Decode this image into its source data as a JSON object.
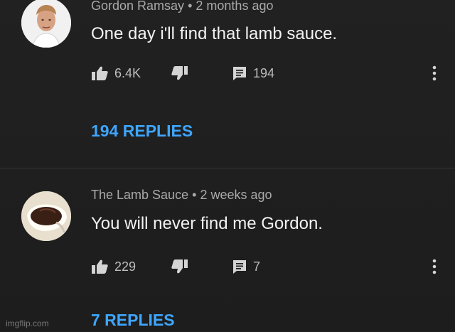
{
  "comments": [
    {
      "author": "Gordon Ramsay",
      "separator": "•",
      "time": "2 months ago",
      "text": "One day i'll find that lamb sauce.",
      "likes": "6.4K",
      "reply_count": "194",
      "replies_link": "194 REPLIES"
    },
    {
      "author": "The Lamb Sauce",
      "separator": "•",
      "time": "2 weeks ago",
      "text": "You will never find me Gordon.",
      "likes": "229",
      "reply_count": "7",
      "replies_link": "7 REPLIES"
    }
  ],
  "watermark": "imgflip.com",
  "icons": {
    "like": "thumbs-up-icon",
    "dislike": "thumbs-down-icon",
    "reply": "comment-icon",
    "more": "more-vert-icon"
  },
  "colors": {
    "background": "#1f1f1f",
    "replies_link": "#3ea6ff",
    "meta_text": "#a9a9a9",
    "comment_text": "#f2f2f2"
  }
}
